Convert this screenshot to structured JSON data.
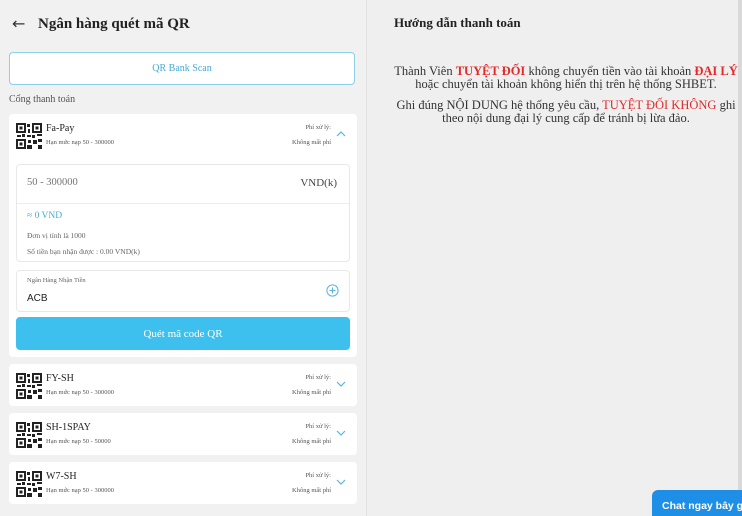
{
  "header": {
    "back_icon": "←",
    "title": "Ngân hàng quét mã QR"
  },
  "scan_button": "QR Bank Scan",
  "section_label": "Cổng thanh toán",
  "methods": [
    {
      "name": "Fa-Pay",
      "limit": "Hạn mức nạp 50 - 300000",
      "fee_label": "Phí xử lý:",
      "fee_value": "Không mất phí",
      "expanded": true
    },
    {
      "name": "FY-SH",
      "limit": "Hạn mức nạp 50 - 300000",
      "fee_label": "Phí xử lý:",
      "fee_value": "Không mất phí",
      "expanded": false
    },
    {
      "name": "SH-1SPAY",
      "limit": "Hạn mức nạp 50 - 50000",
      "fee_label": "Phí xử lý:",
      "fee_value": "Không mất phí",
      "expanded": false
    },
    {
      "name": "W7-SH",
      "limit": "Hạn mức nạp 50 - 300000",
      "fee_label": "Phí xử lý:",
      "fee_value": "Không mất phí",
      "expanded": false
    }
  ],
  "form": {
    "amount_placeholder": "50 - 300000",
    "amount_unit": "VND(k)",
    "converted": "≈ 0 VND",
    "unit_note": "Đơn vị tính là 1000",
    "receive_note": "Số tiền bạn nhận được : 0.00 VND(k)",
    "bank_label": "Ngân Hàng Nhận Tiền",
    "bank_value": "ACB",
    "submit_label": "Quét mã code QR"
  },
  "guide": {
    "title": "Hướng dẫn thanh toán",
    "p1_a": "Thành Viên ",
    "p1_b": "TUYỆT ĐỐI",
    "p1_c": " không chuyển tiền vào tài khoản ",
    "p1_d": "ĐẠI LÝ",
    "p1_e": " hoặc chuyển tài khoản không hiển thị trên hệ thống SHBET.",
    "p2_a": "Ghi đúng NỘI DUNG hệ thống yêu cầu, ",
    "p2_b": "TUYỆT ĐỐI KHÔNG",
    "p2_c": " ghi theo nội dung đại lý cung cấp để tránh bị lừa đảo."
  },
  "chat_button": "Chat ngay bây giờ",
  "colors": {
    "accent": "#3ec0ee",
    "link": "#4aa9d6",
    "warning": "#e22a2a",
    "chat": "#1e8fe6"
  }
}
